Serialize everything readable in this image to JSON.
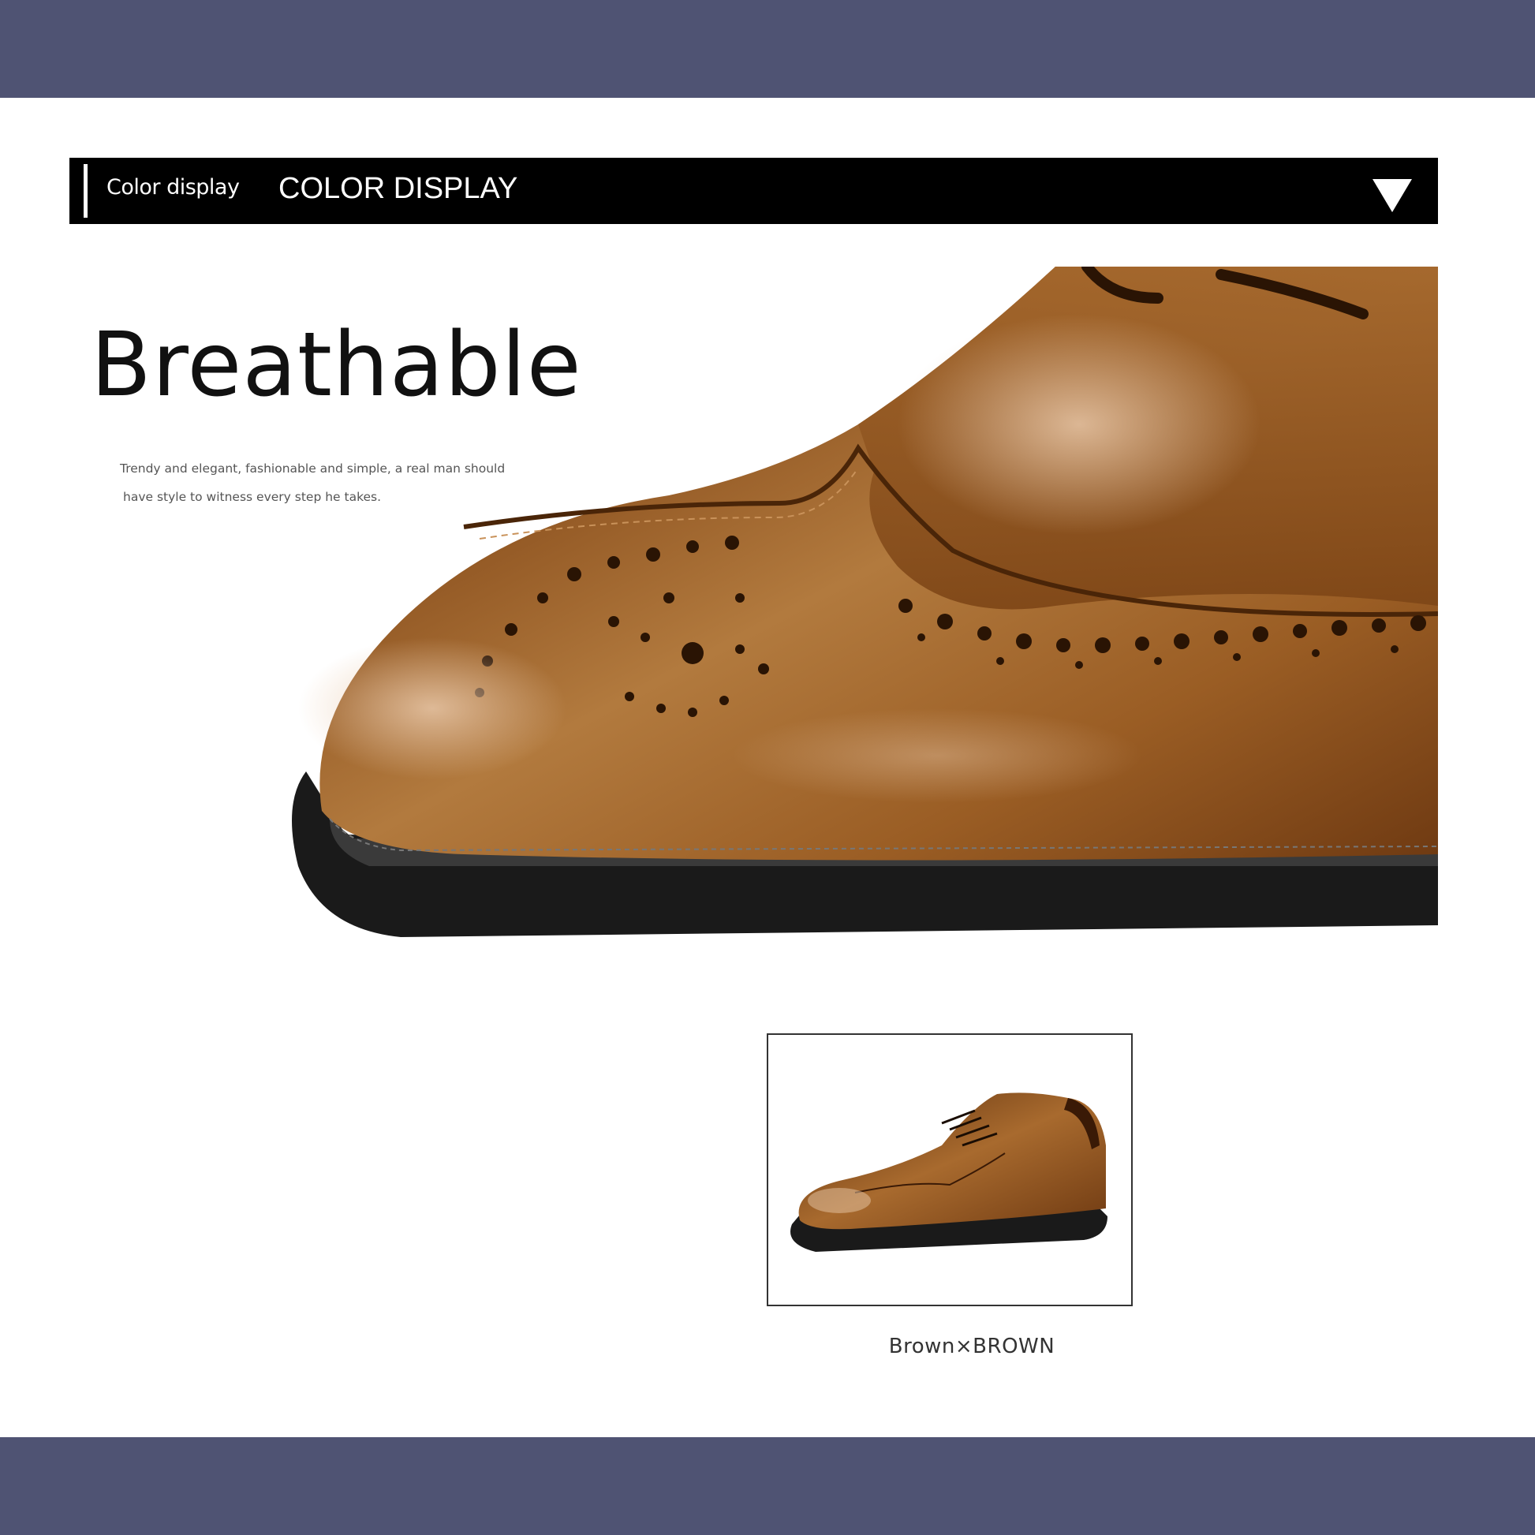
{
  "colors": {
    "band": "#4f5373",
    "header_bg": "#000000",
    "header_text": "#ffffff",
    "leather": "#8a4f1d"
  },
  "section_header": {
    "label_small": "Color display",
    "label_large": "COLOR DISPLAY",
    "toggle_icon": "triangle-down-icon"
  },
  "feature": {
    "headline": "Breathable",
    "description_lines": [
      "Trendy and elegant, fashionable and simple, a real man should",
      "have style to witness every step he takes."
    ]
  },
  "color_options": [
    {
      "label": "Brown×BROWN"
    }
  ]
}
